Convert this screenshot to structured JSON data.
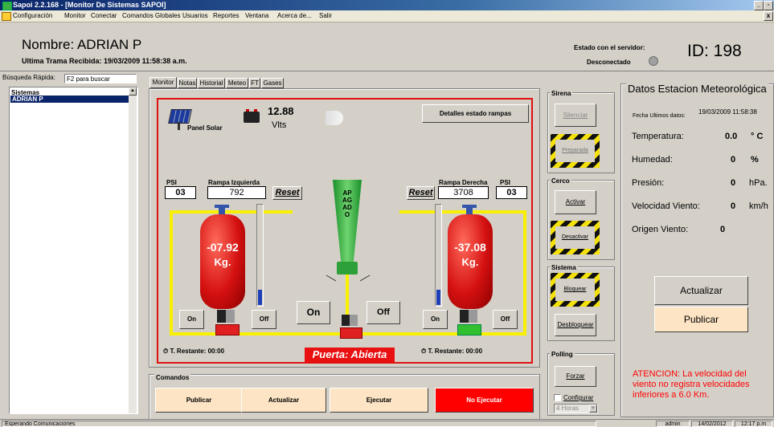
{
  "titlebar": {
    "title": "Sapoi  2.2.168 - [Monitor De Sistemas SAPOI]"
  },
  "menu": [
    "Configuración",
    "Monitor",
    "Conectar",
    "Comandos Globales",
    "Usuarios",
    "Reportes",
    "Ventana",
    "Acerca de...",
    "Salir"
  ],
  "header": {
    "name": "Nombre: ADRIAN P",
    "last_frame": "Ultima Trama Recibida: 19/03/2009 11:58:38 a.m.",
    "server_state_label": "Estado con el servidor:",
    "server_state": "Desconectado",
    "id": "ID: 198"
  },
  "sidebar": {
    "search_label": "Búsqueda Rápida:",
    "search_value": "F2 para buscar",
    "list_title": "Sistemas",
    "items": [
      "ADRIAN P"
    ]
  },
  "tabs": [
    "Monitor",
    "Notas",
    "Historial",
    "Meteo",
    "FT",
    "Gases"
  ],
  "monitor": {
    "panel_label": "Panel Solar",
    "voltage": "12.88",
    "voltage_unit": "Vlts",
    "details_button": "Detalles estado rampas",
    "left": {
      "psi_label": "PSI",
      "psi": "03",
      "ramp_label": "Rampa Izquierda",
      "ramp": "792",
      "reset": "Reset",
      "weight": "-07.92",
      "unit": "Kg.",
      "on": "On",
      "off": "Off",
      "timer": "T. Restante: 00:00",
      "level": 0.15
    },
    "right": {
      "psi_label": "PSI",
      "psi": "03",
      "ramp_label": "Rampa Derecha",
      "ramp": "3708",
      "reset": "Reset",
      "weight": "-37.08",
      "unit": "Kg.",
      "on": "On",
      "off": "Off",
      "timer": "T. Restante: 00:00",
      "level": 0.15
    },
    "center_state": "APAGADO",
    "center_on": "On",
    "center_off": "Off",
    "door": "Puerta: Abierta"
  },
  "commands": {
    "title": "Comandos",
    "buttons": [
      "Publicar",
      "Actualizar",
      "Ejecutar",
      "No Ejecutar"
    ]
  },
  "controls": {
    "sirena": {
      "title": "Sirena",
      "silenciar": "Silenciar",
      "preparada": "Preparada"
    },
    "cerco": {
      "title": "Cerco",
      "activar": "Activar",
      "desactivar": "Desactivar"
    },
    "sistema": {
      "title": "Sistema",
      "bloquear": "Bloquear",
      "desbloquear": "Desbloquear"
    },
    "polling": {
      "title": "Polling",
      "forzar": "Forzar",
      "configurar": "Configurar",
      "interval": "4 Horas"
    }
  },
  "weather": {
    "title": "Datos Estacion Meteorológica",
    "date_label": "Fecha Ultimos datos:",
    "date": "19/03/2009 11:58:38",
    "rows": [
      {
        "label": "Temperatura:",
        "value": "0.0",
        "unit": "° C"
      },
      {
        "label": "Humedad:",
        "value": "0",
        "unit": "%"
      },
      {
        "label": "Presión:",
        "value": "0",
        "unit": "hPa."
      },
      {
        "label": "Velocidad Viento:",
        "value": "0",
        "unit": "km/h"
      },
      {
        "label": "Origen Viento:",
        "value": "0",
        "unit": ""
      }
    ],
    "update_button": "Actualizar",
    "publish_button": "Publicar",
    "warning": "ATENCION: La velocidad del viento no registra velocidades inferiores a 6.0 Km."
  },
  "status": {
    "left": "Esperando Comunicaciones",
    "user": "admin",
    "date": "14/02/2012",
    "time": "12:17 p.m"
  },
  "colors": {
    "accent": "#ff0000",
    "hazard": "#f5e10a",
    "green": "#3cb043"
  }
}
